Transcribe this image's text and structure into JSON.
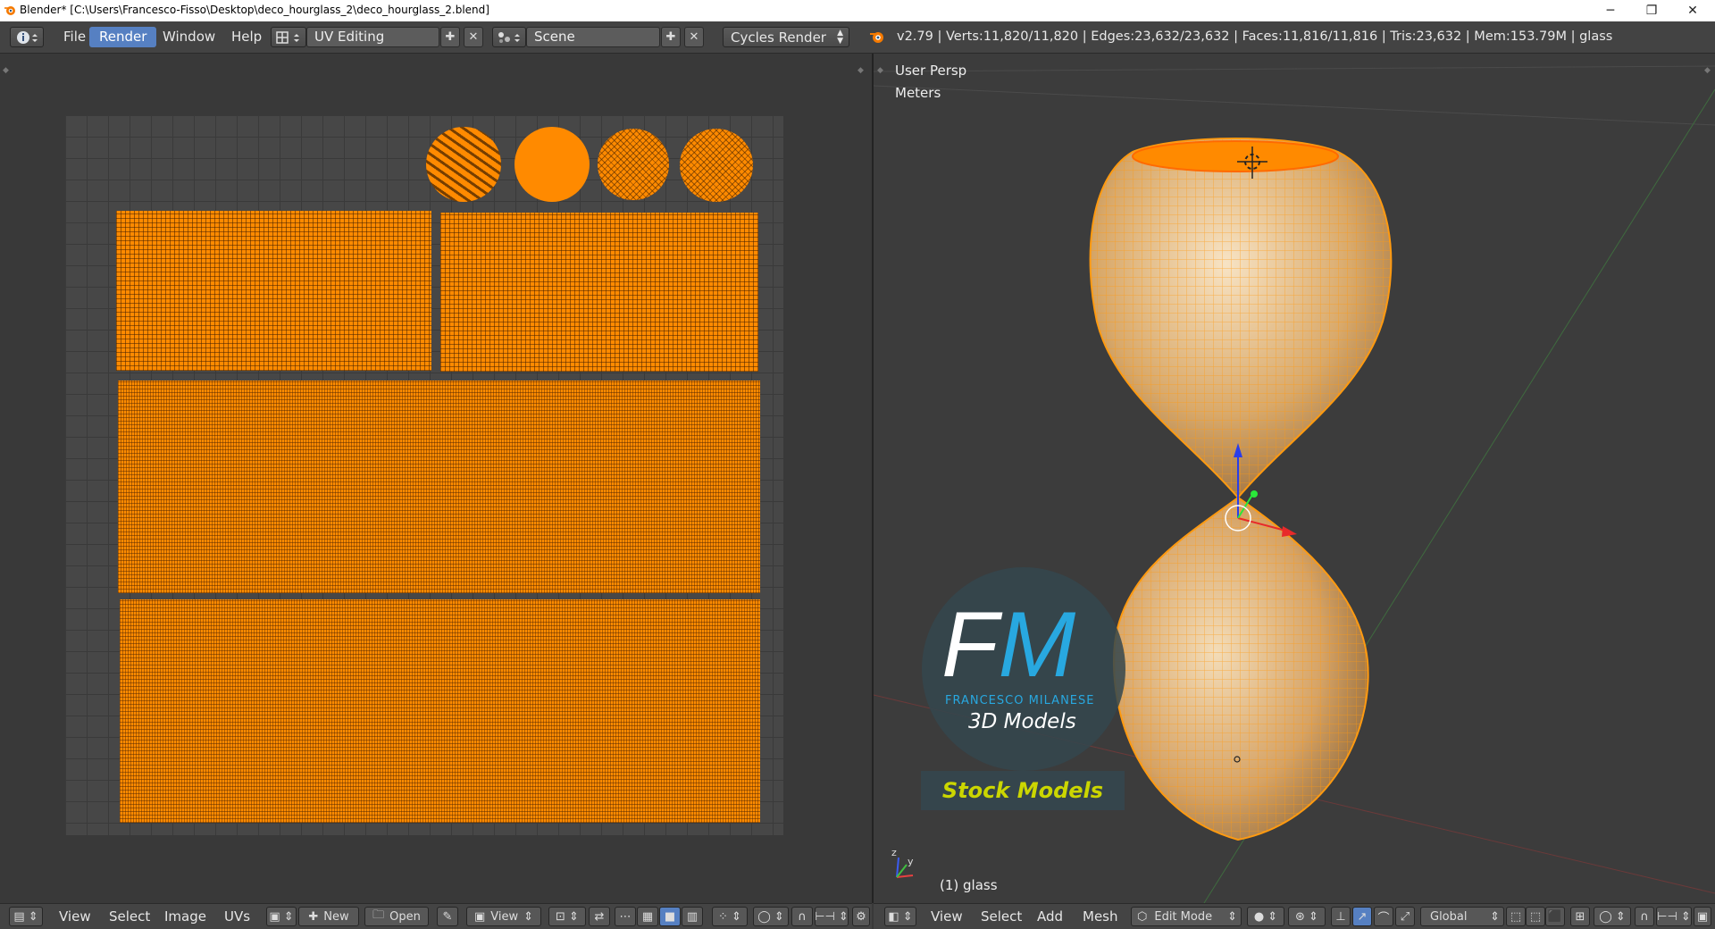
{
  "window": {
    "title": "Blender* [C:\\Users\\Francesco-Fisso\\Desktop\\deco_hourglass_2\\deco_hourglass_2.blend]",
    "minimize": "─",
    "maximize": "❐",
    "close": "✕"
  },
  "info_header": {
    "menus": [
      "File",
      "Render",
      "Window",
      "Help"
    ],
    "screen_layout": "UV Editing",
    "scene": "Scene",
    "render_engine": "Cycles Render",
    "stats": "v2.79 | Verts:11,820/11,820 | Edges:23,632/23,632 | Faces:11,816/11,816 | Tris:23,632 | Mem:153.79M | glass"
  },
  "view3d": {
    "view_name": "User Persp",
    "units": "Meters",
    "object_label": "(1) glass"
  },
  "watermark": {
    "initials_f": "F",
    "initials_m": "M",
    "brand": "FRANCESCO MILANESE",
    "subtitle": "3D Models",
    "banner": "Stock Models"
  },
  "uv_header": {
    "menus": [
      "View",
      "Select",
      "Image",
      "UVs"
    ],
    "new_label": "New",
    "open_label": "Open",
    "view_label": "View"
  },
  "view3d_header": {
    "menus": [
      "View",
      "Select",
      "Add",
      "Mesh"
    ],
    "mode": "Edit Mode",
    "orientation": "Global"
  },
  "colors": {
    "accent": "#5680c2",
    "selection": "#ff8a00",
    "background": "#393939"
  }
}
